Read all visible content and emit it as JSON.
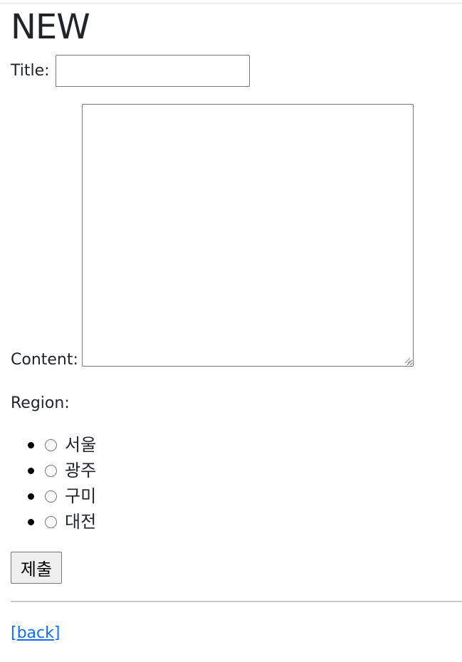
{
  "page": {
    "heading": "NEW"
  },
  "form": {
    "title_label": "Title:",
    "title_value": "",
    "content_label": "Content:",
    "content_value": "",
    "region_label": "Region:",
    "regions": [
      {
        "label": "서울",
        "selected": false
      },
      {
        "label": "광주",
        "selected": false
      },
      {
        "label": "구미",
        "selected": false
      },
      {
        "label": "대전",
        "selected": false
      }
    ],
    "submit_label": "제출"
  },
  "footer": {
    "back_open": "[",
    "back_link": "back",
    "back_close": "]"
  },
  "colors": {
    "link": "#0d6efd",
    "text": "#212529"
  }
}
